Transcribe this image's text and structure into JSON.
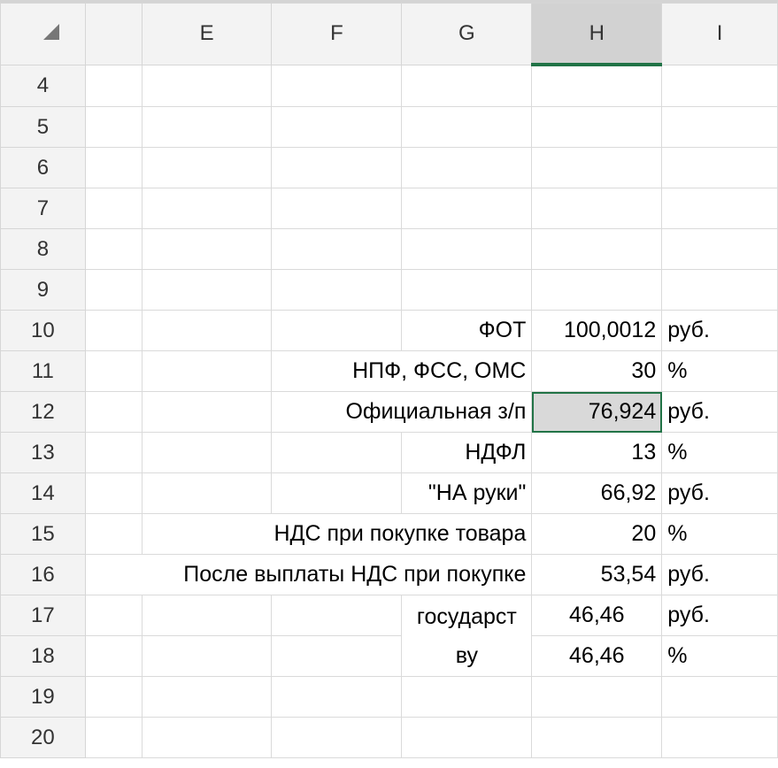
{
  "columns": [
    "",
    "E",
    "F",
    "G",
    "H",
    "I"
  ],
  "selected_column": "H",
  "rows": [
    "4",
    "5",
    "6",
    "7",
    "8",
    "9",
    "10",
    "11",
    "12",
    "13",
    "14",
    "15",
    "16",
    "17",
    "18",
    "19",
    "20"
  ],
  "cells": {
    "r10": {
      "label": "ФОТ",
      "value": "100,0012",
      "unit": "руб."
    },
    "r11": {
      "label": "НПФ, ФСС, ОМС",
      "value": "30",
      "unit": "%"
    },
    "r12": {
      "label": "Официальная з/п",
      "value": "76,924",
      "unit": "руб."
    },
    "r13": {
      "label": "НДФЛ",
      "value": "13",
      "unit": "%"
    },
    "r14": {
      "label": "\"НА руки\"",
      "value": "66,92",
      "unit": "руб."
    },
    "r15": {
      "label": "НДС при покупке товара",
      "value": "20",
      "unit": "%"
    },
    "r16": {
      "label": "После выплаты НДС при покупке",
      "value": "53,54",
      "unit": "руб."
    },
    "r17": {
      "label": "государству",
      "value": "46,46",
      "unit": "руб."
    },
    "r18": {
      "value": "46,46",
      "unit": "%"
    }
  },
  "accent": "#217346"
}
